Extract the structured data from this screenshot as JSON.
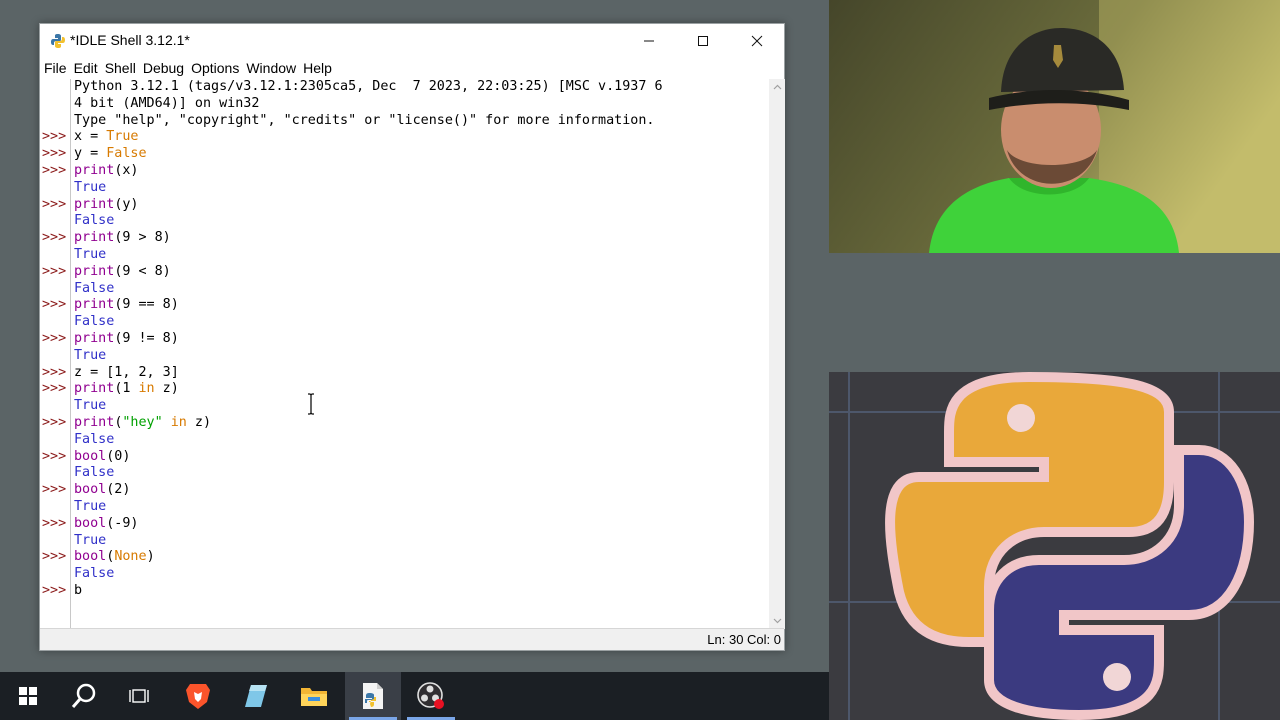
{
  "window": {
    "title": "*IDLE Shell 3.12.1*",
    "menu": [
      "File",
      "Edit",
      "Shell",
      "Debug",
      "Options",
      "Window",
      "Help"
    ]
  },
  "shell": {
    "prompt": ">>>",
    "banner": [
      "Python 3.12.1 (tags/v3.12.1:2305ca5, Dec  7 2023, 22:03:25) [MSC v.1937 6",
      "4 bit (AMD64)] on win32",
      "Type \"help\", \"copyright\", \"credits\" or \"license()\" for more information."
    ],
    "lines": [
      {
        "kind": "input",
        "text": "x = True"
      },
      {
        "kind": "input",
        "text": "y = False"
      },
      {
        "kind": "input",
        "text": "print(x)"
      },
      {
        "kind": "output",
        "text": "True"
      },
      {
        "kind": "input",
        "text": "print(y)"
      },
      {
        "kind": "output",
        "text": "False"
      },
      {
        "kind": "input",
        "text": "print(9 > 8)"
      },
      {
        "kind": "output",
        "text": "True"
      },
      {
        "kind": "input",
        "text": "print(9 < 8)"
      },
      {
        "kind": "output",
        "text": "False"
      },
      {
        "kind": "input",
        "text": "print(9 == 8)"
      },
      {
        "kind": "output",
        "text": "False"
      },
      {
        "kind": "input",
        "text": "print(9 != 8)"
      },
      {
        "kind": "output",
        "text": "True"
      },
      {
        "kind": "input",
        "text": "z = [1, 2, 3]"
      },
      {
        "kind": "input",
        "text": "print(1 in z)"
      },
      {
        "kind": "output",
        "text": "True"
      },
      {
        "kind": "input",
        "text": "print(\"hey\" in z)"
      },
      {
        "kind": "output",
        "text": "False"
      },
      {
        "kind": "input",
        "text": "bool(0)"
      },
      {
        "kind": "output",
        "text": "False"
      },
      {
        "kind": "input",
        "text": "bool(2)"
      },
      {
        "kind": "output",
        "text": "True"
      },
      {
        "kind": "input",
        "text": "bool(-9)"
      },
      {
        "kind": "output",
        "text": "True"
      },
      {
        "kind": "input",
        "text": "bool(None)"
      },
      {
        "kind": "output",
        "text": "False"
      },
      {
        "kind": "input",
        "text": "b"
      }
    ]
  },
  "status": {
    "text": "Ln: 30 Col: 0"
  },
  "taskbar": {
    "items": [
      "start-icon",
      "search-icon",
      "task-view-icon",
      "brave-browser-icon",
      "notes-app-icon",
      "file-explorer-icon",
      "idle-python-icon",
      "obs-studio-icon"
    ],
    "active": "idle-python-icon"
  },
  "colors": {
    "prompt": "#8b1a1a",
    "keyword": "#d77a00",
    "builtin": "#900090",
    "string": "#00a000",
    "output": "#3030c8",
    "desktop": "#5b6466"
  }
}
